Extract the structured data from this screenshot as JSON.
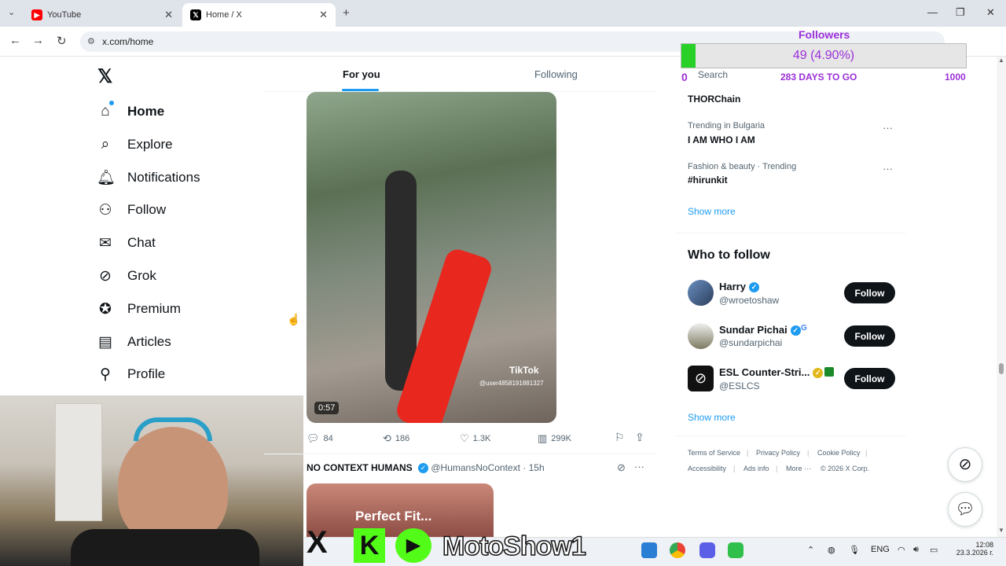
{
  "browser": {
    "tabs": [
      {
        "label": "YouTube",
        "active": false
      },
      {
        "label": "Home / X",
        "active": true
      }
    ],
    "address": "x.com/home"
  },
  "overlay": {
    "label": "Followers",
    "progress_text": "49 (4.90%)",
    "progress_fraction": 0.049,
    "start": "0",
    "days": "283 DAYS TO GO",
    "goal": "1000"
  },
  "search_placeholder": "Search",
  "nav": {
    "items": [
      {
        "label": "Home",
        "icon": "home-icon"
      },
      {
        "label": "Explore",
        "icon": "search-icon"
      },
      {
        "label": "Notifications",
        "icon": "bell-icon"
      },
      {
        "label": "Follow",
        "icon": "person-plus-icon"
      },
      {
        "label": "Chat",
        "icon": "mail-icon"
      },
      {
        "label": "Grok",
        "icon": "grok-icon"
      },
      {
        "label": "Premium",
        "icon": "premium-icon"
      },
      {
        "label": "Articles",
        "icon": "articles-icon"
      },
      {
        "label": "Profile",
        "icon": "person-icon"
      }
    ]
  },
  "feed": {
    "tabs": [
      "For you",
      "Following"
    ],
    "video": {
      "duration": "0:57",
      "watermark": "TikTok",
      "watermark_user": "@user4858191881327"
    },
    "metrics": {
      "replies": "84",
      "reposts": "186",
      "likes": "1.3K",
      "views": "299K"
    },
    "next_post": {
      "author": "NO CONTEXT HUMANS",
      "handle": "@HumansNoContext",
      "time": "· 15h",
      "image_text": "Perfect Fit..."
    }
  },
  "trends": [
    {
      "context": "",
      "title": "THORChain"
    },
    {
      "context": "Trending in Bulgaria",
      "title": "I AM WHO I AM"
    },
    {
      "context": "Fashion & beauty · Trending",
      "title": "#hirunkit"
    }
  ],
  "show_more": "Show more",
  "who_to_follow": {
    "title": "Who to follow",
    "users": [
      {
        "name": "Harry",
        "handle": "@wroetoshaw"
      },
      {
        "name": "Sundar Pichai",
        "handle": "@sundarpichai"
      },
      {
        "name": "ESL Counter-Stri...",
        "handle": "@ESLCS"
      }
    ],
    "button": "Follow"
  },
  "footer": {
    "links": [
      "Terms of Service",
      "Privacy Policy",
      "Cookie Policy",
      "Accessibility",
      "Ads info",
      "More ···",
      "© 2026 X Corp."
    ]
  },
  "stream_banner": "MotoShow1",
  "taskbar": {
    "lang": "ENG",
    "time": "12:08",
    "date": "23.3.2026 г."
  }
}
